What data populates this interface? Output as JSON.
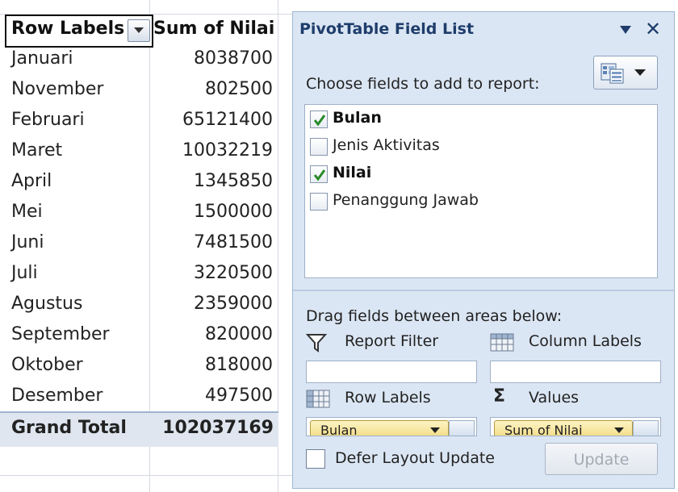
{
  "pivot_table": {
    "header": {
      "row_labels": "Row Labels",
      "sum_header": "Sum of Nilai"
    },
    "rows": [
      {
        "label": "Januari",
        "value": "8038700"
      },
      {
        "label": "November",
        "value": "802500"
      },
      {
        "label": "Februari",
        "value": "65121400"
      },
      {
        "label": "Maret",
        "value": "10032219"
      },
      {
        "label": "April",
        "value": "1345850"
      },
      {
        "label": "Mei",
        "value": "1500000"
      },
      {
        "label": "Juni",
        "value": "7481500"
      },
      {
        "label": "Juli",
        "value": "3220500"
      },
      {
        "label": "Agustus",
        "value": "2359000"
      },
      {
        "label": "September",
        "value": "820000"
      },
      {
        "label": "Oktober",
        "value": "818000"
      },
      {
        "label": "Desember",
        "value": "497500"
      }
    ],
    "grand_total": {
      "label": "Grand Total",
      "value": "102037169"
    }
  },
  "field_list": {
    "title": "PivotTable Field List",
    "choose_text": "Choose fields to add to report:",
    "fields": [
      {
        "label": "Bulan",
        "checked": true
      },
      {
        "label": "Jenis Aktivitas",
        "checked": false
      },
      {
        "label": "Nilai",
        "checked": true
      },
      {
        "label": "Penanggung Jawab",
        "checked": false
      }
    ],
    "drag_text": "Drag fields between areas below:",
    "areas": {
      "report_filter": "Report Filter",
      "column_labels": "Column Labels",
      "row_labels": "Row Labels",
      "values": "Values"
    },
    "row_field_pill": "Bulan",
    "values_field_pill": "Sum of Nilai",
    "defer_label": "Defer Layout Update",
    "defer_checked": false,
    "update_label": "Update"
  },
  "icons": {
    "filter_dropdown": "filter-dropdown-icon",
    "menu_arrow": "chevron-down-icon",
    "close": "close-icon",
    "layout": "field-layout-icon",
    "report_filter": "funnel-icon",
    "column_labels": "grid-icon",
    "row_labels": "grid-icon",
    "values": "sigma-icon"
  },
  "colors": {
    "panel_bg": "#dbe6f4",
    "title_text": "#1e3d6b",
    "check_green": "#2a8a2a",
    "pill_gold": "#f1d77a",
    "grand_total_bg": "#dfe6f0"
  }
}
